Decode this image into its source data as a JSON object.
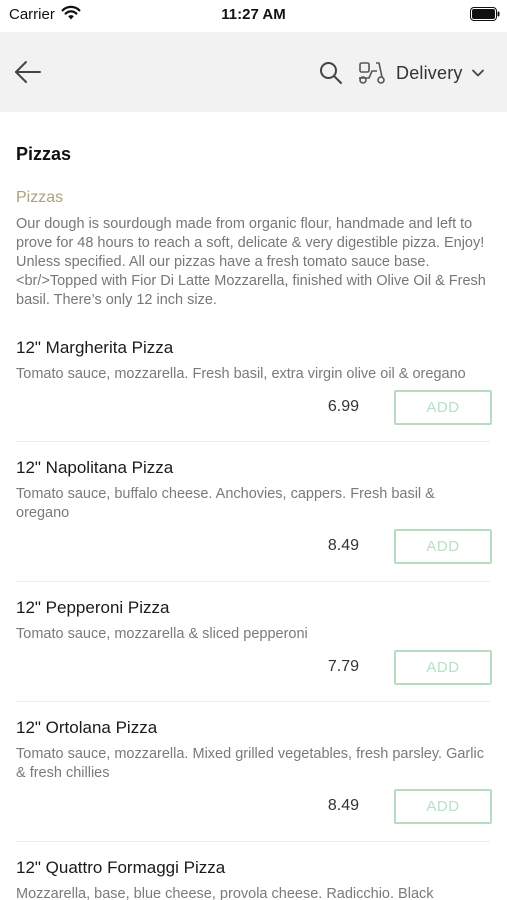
{
  "status": {
    "carrier": "Carrier",
    "time": "11:27 AM"
  },
  "nav": {
    "delivery_label": "Delivery"
  },
  "section": {
    "title": "Pizzas"
  },
  "category": {
    "name": "Pizzas",
    "description": "Our dough is sourdough made from organic flour, handmade and left to prove for 48 hours to reach a soft, delicate & very digestible pizza. Enjoy! Unless specified. All our pizzas have a fresh tomato sauce base.<br/>Topped with Fior Di Latte Mozzarella, finished with Olive Oil & Fresh basil. There’s only 12 inch size."
  },
  "items": [
    {
      "name": "12\" Margherita Pizza",
      "description": "Tomato sauce, mozzarella. Fresh basil, extra virgin olive oil & oregano",
      "price": "6.99",
      "add_label": "ADD"
    },
    {
      "name": "12\" Napolitana Pizza",
      "description": "Tomato sauce, buffalo cheese. Anchovies, cappers. Fresh basil & oregano",
      "price": "8.49",
      "add_label": "ADD"
    },
    {
      "name": "12\" Pepperoni Pizza",
      "description": "Tomato sauce, mozzarella & sliced pepperoni",
      "price": "7.79",
      "add_label": "ADD"
    },
    {
      "name": "12\" Ortolana Pizza",
      "description": "Tomato sauce, mozzarella. Mixed grilled vegetables, fresh parsley. Garlic & fresh chillies",
      "price": "8.49",
      "add_label": "ADD"
    },
    {
      "name": "12\" Quattro Formaggi Pizza",
      "description": "Mozzarella, base, blue cheese, provola cheese. Radicchio. Black"
    }
  ],
  "icons": {
    "back": "arrow-left-icon",
    "search": "search-icon",
    "delivery": "scooter-icon",
    "dropdown": "chevron-down-icon"
  },
  "colors": {
    "nav_background": "#f2f2f2",
    "category_name": "#a9a27a",
    "add_button_border": "#b6ddc0",
    "add_button_text": "#b8dfc3"
  }
}
